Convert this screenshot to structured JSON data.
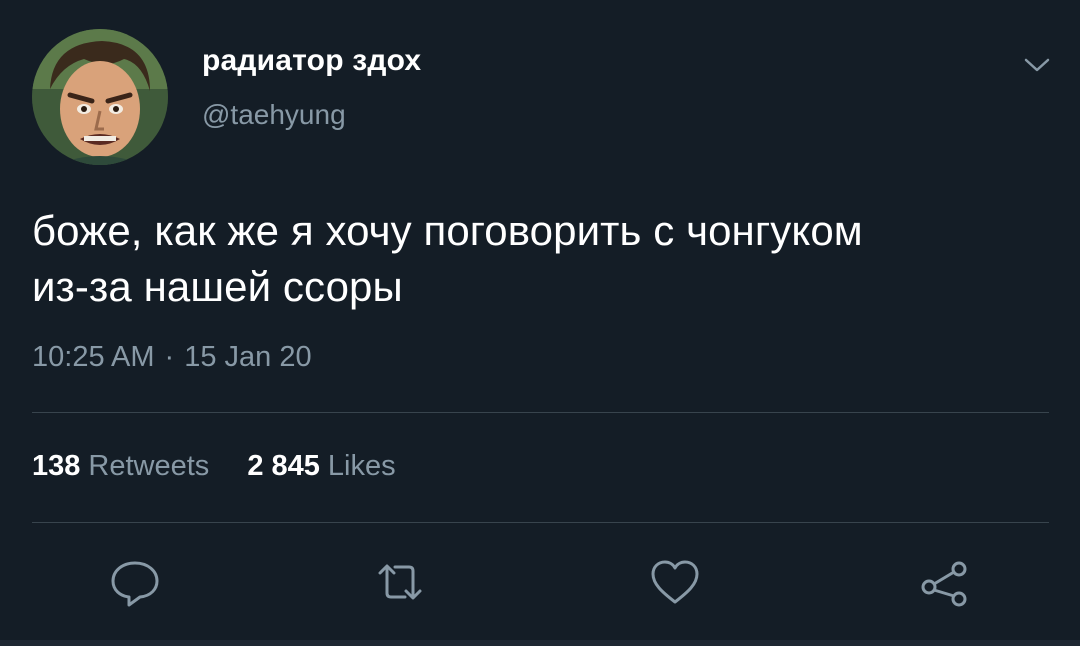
{
  "user": {
    "display_name": "радиатор здох",
    "handle": "@taehyung"
  },
  "tweet": {
    "text_line1": "боже, как же я хочу поговорить с чонгуком",
    "text_line2": "из-за нашей ссоры",
    "time": "10:25 AM",
    "separator": "·",
    "date": "15 Jan 20"
  },
  "stats": {
    "retweets_count": "138",
    "retweets_label": "Retweets",
    "likes_count": "2 845",
    "likes_label": "Likes"
  },
  "icons": {
    "caret": "chevron-down-icon",
    "reply": "reply-icon",
    "retweet": "retweet-icon",
    "like": "heart-icon",
    "share": "share-icon"
  },
  "colors": {
    "background": "#141d26",
    "secondary_text": "#8899a6",
    "divider": "#38444d"
  }
}
